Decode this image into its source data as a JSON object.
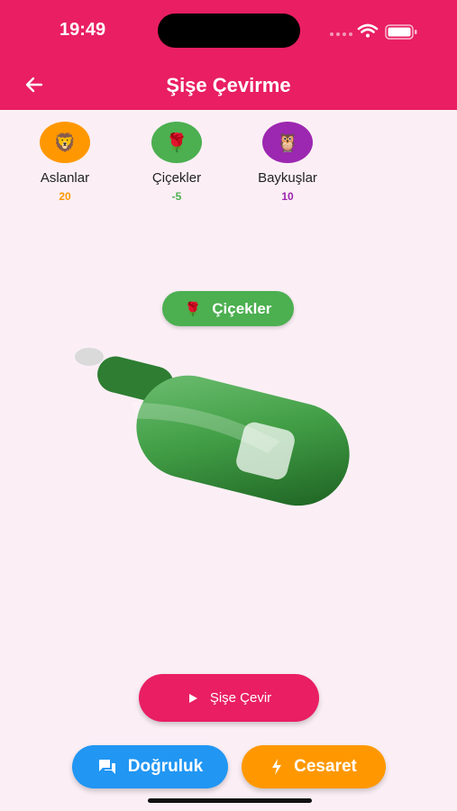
{
  "status_bar": {
    "time": "19:49"
  },
  "app_bar": {
    "title": "Şişe Çevirme",
    "back_icon": "arrow-left-icon"
  },
  "teams": [
    {
      "name": "Aslanlar",
      "score": "20",
      "emoji": "🦁",
      "color": "#FF9800",
      "score_color": "#FF9800"
    },
    {
      "name": "Çiçekler",
      "score": "-5",
      "emoji": "🌹",
      "color": "#4CAF50",
      "score_color": "#4CAF50"
    },
    {
      "name": "Baykuşlar",
      "score": "10",
      "emoji": "🦉",
      "color": "#9C27B0",
      "score_color": "#9C27B0"
    }
  ],
  "current_team": {
    "label": "Çiçekler",
    "emoji": "🌹",
    "color": "#4CAF50"
  },
  "bottle": {
    "color": "#2E7D32",
    "icon": "bottle-icon"
  },
  "actions": {
    "spin_label": "Şişe Çevir",
    "truth_label": "Doğruluk",
    "dare_label": "Cesaret"
  },
  "colors": {
    "primary": "#E91E63",
    "background": "#FBEFF5",
    "truth": "#2196F3",
    "dare": "#FF9800"
  }
}
